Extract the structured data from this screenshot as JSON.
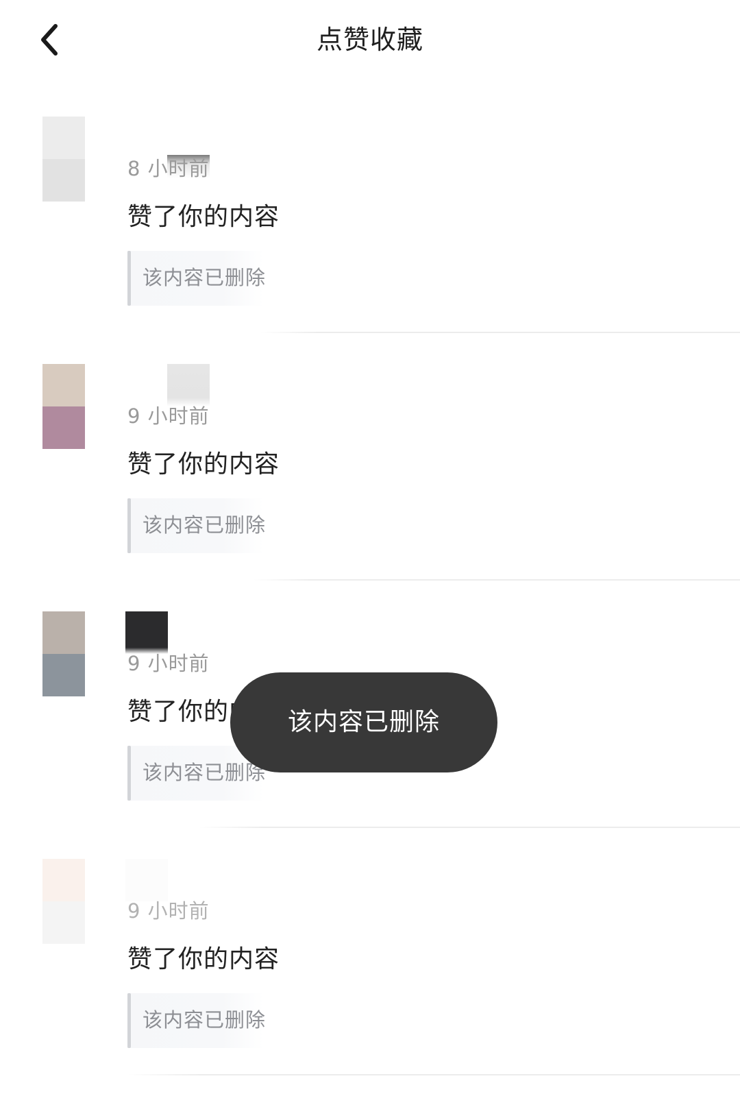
{
  "header": {
    "title": "点赞收藏",
    "back_icon": "chevron-left-icon"
  },
  "items": [
    {
      "time": "8 小时前",
      "action": "赞了你的内容",
      "quote": "该内容已删除",
      "avatar_colors": [
        "#ececec",
        "#e2e2e2"
      ],
      "name_block_color": "#e6e6e6"
    },
    {
      "time": "9 小时前",
      "action": "赞了你的内容",
      "quote": "该内容已删除",
      "avatar_colors": [
        "#d8cbbf",
        "#b08a9e"
      ],
      "name_block_color": "#e4e4e4"
    },
    {
      "time": "9 小时前",
      "action": "赞了你的内容",
      "quote": "该内容已删除",
      "avatar_colors": [
        "#bab1aa",
        "#8c949c"
      ],
      "name_block_color": "#2b2b2d"
    },
    {
      "time": "9 小时前",
      "action": "赞了你的内容",
      "quote": "该内容已删除",
      "avatar_colors": [
        "#faf1ec",
        "#f4f4f4"
      ],
      "name_block_color": "#fcfcfc"
    }
  ],
  "toast": {
    "text": "该内容已删除"
  }
}
